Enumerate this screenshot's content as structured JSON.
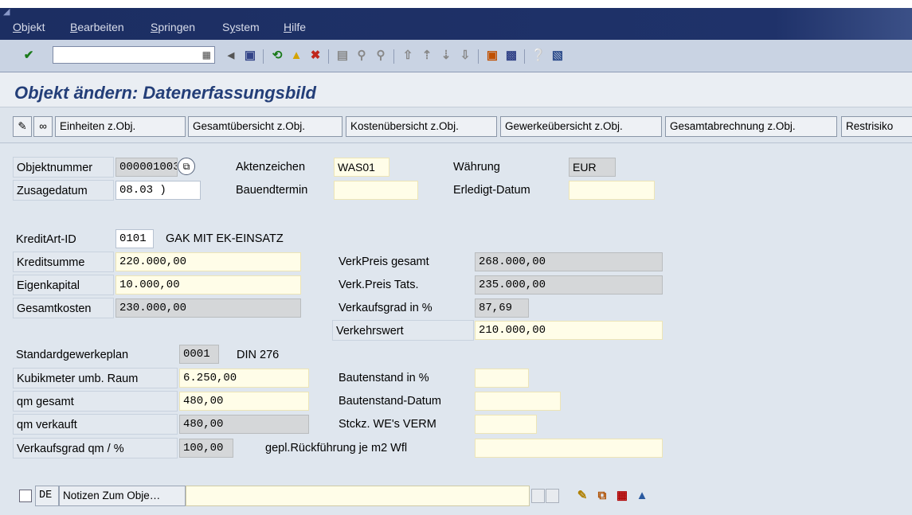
{
  "menu": {
    "items": [
      {
        "label": "Objekt",
        "hot": "O",
        "rest": "bjekt"
      },
      {
        "label": "Bearbeiten",
        "hot": "B",
        "rest": "earbeiten"
      },
      {
        "label": "Springen",
        "hot": "S",
        "rest": "pringen"
      },
      {
        "label": "System",
        "hot": "y",
        "pre": "S",
        "rest": "stem"
      },
      {
        "label": "Hilfe",
        "hot": "H",
        "rest": "ilfe"
      }
    ]
  },
  "toolbar": {
    "command_value": ""
  },
  "page_title": "Objekt ändern: Datenerfassungsbild",
  "app_toolbar": {
    "buttons": [
      "Einheiten z.Obj.",
      "Gesamtübersicht z.Obj.",
      "Kostenübersicht z.Obj.",
      "Gewerkeübersicht z.Obj.",
      "Gesamtabrechnung z.Obj.",
      "Restrisiko"
    ]
  },
  "form": {
    "objektnummer": {
      "label": "Objektnummer",
      "value": "0000010032"
    },
    "aktenzeichen": {
      "label": "Aktenzeichen",
      "value": "WAS01"
    },
    "waehrung": {
      "label": "Währung",
      "value": "EUR"
    },
    "zusagedatum": {
      "label": "Zusagedatum",
      "value": "08.03       )"
    },
    "bauendtermin": {
      "label": "Bauendtermin",
      "value": ""
    },
    "erledigt_datum": {
      "label": "Erledigt-Datum",
      "value": ""
    },
    "kreditart": {
      "label": "KreditArt-ID",
      "value": "0101",
      "text": "GAK MIT EK-EINSATZ"
    },
    "kreditsumme": {
      "label": "Kreditsumme",
      "value": "220.000,00"
    },
    "eigenkapital": {
      "label": "Eigenkapital",
      "value": "10.000,00"
    },
    "gesamtkosten": {
      "label": "Gesamtkosten",
      "value": "230.000,00"
    },
    "verkpreis_gesamt": {
      "label": "VerkPreis gesamt",
      "value": "268.000,00"
    },
    "verkpreis_tats": {
      "label": "Verk.Preis Tats.",
      "value": "235.000,00"
    },
    "verkaufsgrad": {
      "label": "Verkaufsgrad in %",
      "value": "87,69"
    },
    "verkehrswert": {
      "label": "Verkehrswert",
      "value": "210.000,00"
    },
    "standardgewerkeplan": {
      "label": "Standardgewerkeplan",
      "value": "0001",
      "text": "DIN 276"
    },
    "kubikmeter": {
      "label": "Kubikmeter umb. Raum",
      "value": "6.250,00"
    },
    "qm_gesamt": {
      "label": "qm gesamt",
      "value": "480,00"
    },
    "qm_verkauft": {
      "label": "qm verkauft",
      "value": "480,00"
    },
    "verkaufsgrad_qm": {
      "label": "Verkaufsgrad qm / %",
      "value": "100,00"
    },
    "bautenstand": {
      "label": "Bautenstand in %",
      "value": ""
    },
    "bautenstand_datum": {
      "label": "Bautenstand-Datum",
      "value": ""
    },
    "stckz": {
      "label": "Stckz. WE's VERM",
      "value": ""
    },
    "rueckfuehrung": {
      "label": "gepl.Rückführung je m2 Wfl",
      "value": ""
    }
  },
  "footer": {
    "lang": "DE",
    "notes_label": "Notizen Zum Obje…",
    "notes_value": ""
  }
}
